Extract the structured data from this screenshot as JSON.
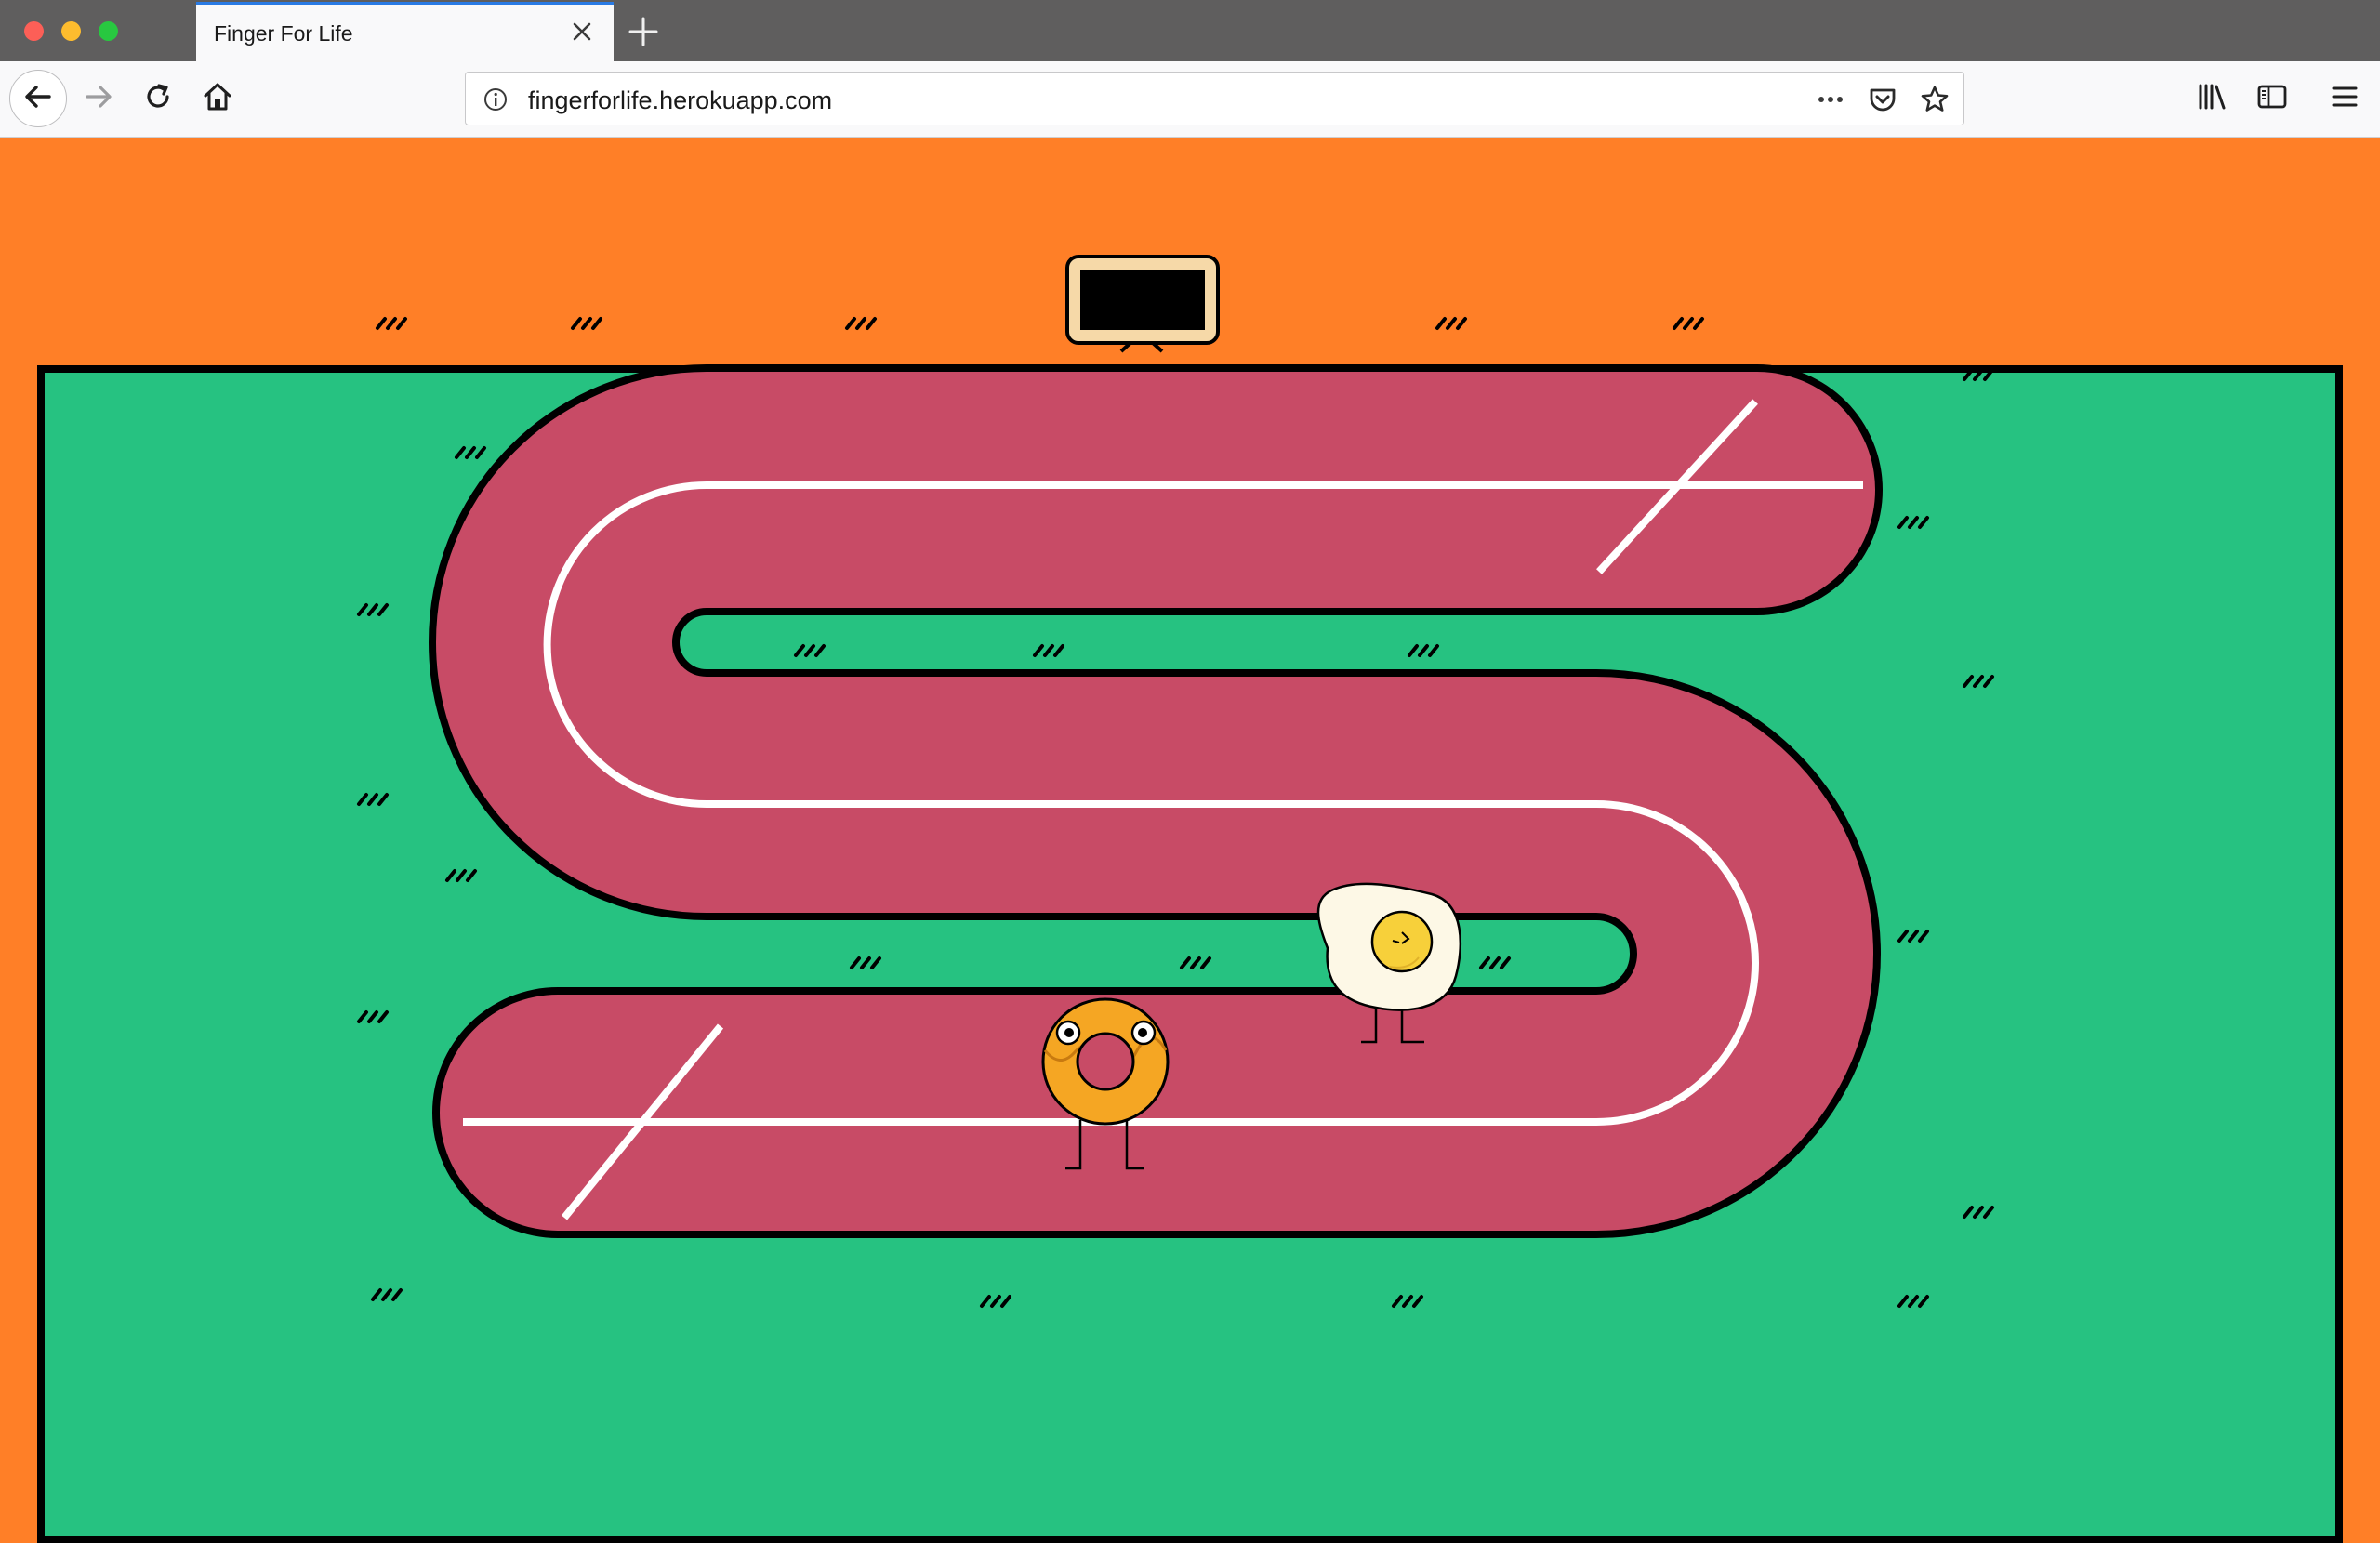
{
  "browser": {
    "tab_title": "Finger For Life",
    "url": "fingerforlife.herokuapp.com",
    "icons": {
      "close_window": "close-window-dot",
      "minimize_window": "minimize-window-dot",
      "maximize_window": "maximize-window-dot",
      "tab_close": "x-icon",
      "new_tab": "plus-icon",
      "back": "arrow-left-icon",
      "forward": "arrow-right-icon",
      "reload": "reload-icon",
      "home": "home-icon",
      "site_info": "info-icon",
      "page_actions": "ellipsis-icon",
      "pocket": "pocket-icon",
      "bookmark": "star-icon",
      "library": "library-icon",
      "sidebar": "sidebar-icon",
      "menu": "hamburger-icon"
    }
  },
  "game": {
    "colors": {
      "background": "#ff7f27",
      "grass": "#26c281",
      "track": "#c84b66",
      "lane": "#ffffff",
      "outline": "#000000",
      "donut": "#f5a623",
      "egg_white": "#fdf8e6",
      "egg_yolk": "#f7d03a"
    },
    "sign_board": "black-screen-sign",
    "players": [
      {
        "name": "donut",
        "character": "donut-character"
      },
      {
        "name": "fried-egg",
        "character": "egg-character"
      }
    ],
    "markers": [
      "start-line",
      "finish-line"
    ]
  }
}
